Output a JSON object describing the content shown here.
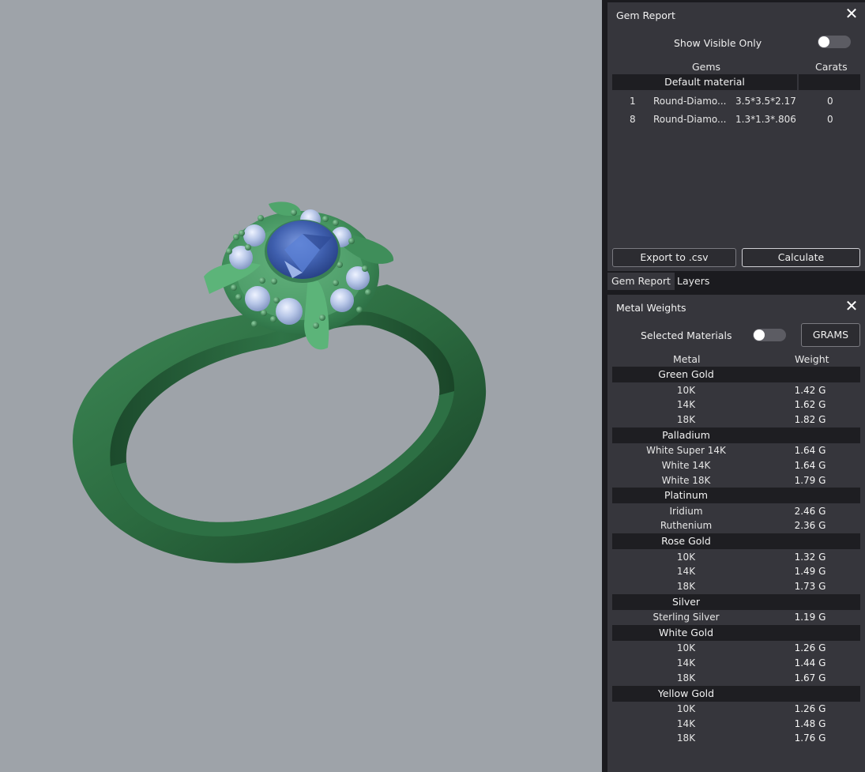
{
  "colors": {
    "viewport_bg": "#9ea3a9",
    "panel_bg": "#36363c",
    "metal_green": "#3d7a4e",
    "gem_blue": "#3f5fae",
    "diamond": "#b8c7e8"
  },
  "gem_report": {
    "title": "Gem Report",
    "show_visible_only_label": "Show Visible Only",
    "col_gems": "Gems",
    "col_carats": "Carats",
    "group": "Default material",
    "rows": [
      {
        "qty": "1",
        "name": "Round-Diamo...",
        "size": "3.5*3.5*2.17",
        "carats": "0"
      },
      {
        "qty": "8",
        "name": "Round-Diamo...",
        "size": "1.3*1.3*.806",
        "carats": "0"
      }
    ],
    "export_label": "Export to .csv",
    "calculate_label": "Calculate"
  },
  "tabs": {
    "gem_report": "Gem Report",
    "layers": "Layers"
  },
  "metal_weights": {
    "title": "Metal Weights",
    "selected_materials_label": "Selected Materials",
    "units_label": "GRAMS",
    "col_metal": "Metal",
    "col_weight": "Weight",
    "groups": [
      {
        "name": "Green Gold",
        "items": [
          {
            "name": "10K",
            "weight": "1.42 G"
          },
          {
            "name": "14K",
            "weight": "1.62 G"
          },
          {
            "name": "18K",
            "weight": "1.82 G"
          }
        ]
      },
      {
        "name": "Palladium",
        "items": [
          {
            "name": "White Super 14K",
            "weight": "1.64 G"
          },
          {
            "name": "White 14K",
            "weight": "1.64 G"
          },
          {
            "name": "White 18K",
            "weight": "1.79 G"
          }
        ]
      },
      {
        "name": "Platinum",
        "items": [
          {
            "name": "Iridium",
            "weight": "2.46 G"
          },
          {
            "name": "Ruthenium",
            "weight": "2.36 G"
          }
        ]
      },
      {
        "name": "Rose Gold",
        "items": [
          {
            "name": "10K",
            "weight": "1.32 G"
          },
          {
            "name": "14K",
            "weight": "1.49 G"
          },
          {
            "name": "18K",
            "weight": "1.73 G"
          }
        ]
      },
      {
        "name": "Silver",
        "items": [
          {
            "name": "Sterling Silver",
            "weight": "1.19 G"
          }
        ]
      },
      {
        "name": "White Gold",
        "items": [
          {
            "name": "10K",
            "weight": "1.26 G"
          },
          {
            "name": "14K",
            "weight": "1.44 G"
          },
          {
            "name": "18K",
            "weight": "1.67 G"
          }
        ]
      },
      {
        "name": "Yellow Gold",
        "items": [
          {
            "name": "10K",
            "weight": "1.26 G"
          },
          {
            "name": "14K",
            "weight": "1.48 G"
          },
          {
            "name": "18K",
            "weight": "1.76 G"
          }
        ]
      }
    ]
  }
}
